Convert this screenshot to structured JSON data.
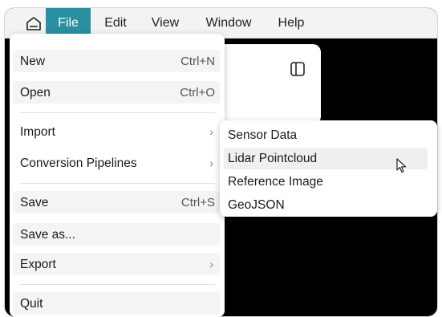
{
  "menubar": {
    "items": [
      {
        "label": "File"
      },
      {
        "label": "Edit"
      },
      {
        "label": "View"
      },
      {
        "label": "Window"
      },
      {
        "label": "Help"
      }
    ],
    "active": "File",
    "accent_color": "#2a8fa0"
  },
  "file_menu": {
    "items": [
      {
        "label": "New",
        "shortcut": "Ctrl+N"
      },
      {
        "label": "Open",
        "shortcut": "Ctrl+O"
      },
      {
        "label": "Import",
        "submenu": true
      },
      {
        "label": "Conversion Pipelines",
        "submenu": true
      },
      {
        "label": "Save",
        "shortcut": "Ctrl+S"
      },
      {
        "label": "Save as..."
      },
      {
        "label": "Export",
        "submenu": true
      },
      {
        "label": "Quit"
      }
    ],
    "chevron": "›"
  },
  "import_submenu": {
    "items": [
      {
        "label": "Sensor Data"
      },
      {
        "label": "Lidar Pointcloud"
      },
      {
        "label": "Reference Image"
      },
      {
        "label": "GeoJSON"
      }
    ],
    "hovered": "Lidar Pointcloud"
  },
  "icons": {
    "home": "home-icon",
    "sidebar_toggle": "sidebar-toggle-icon",
    "cursor": "mouse-pointer-icon"
  }
}
